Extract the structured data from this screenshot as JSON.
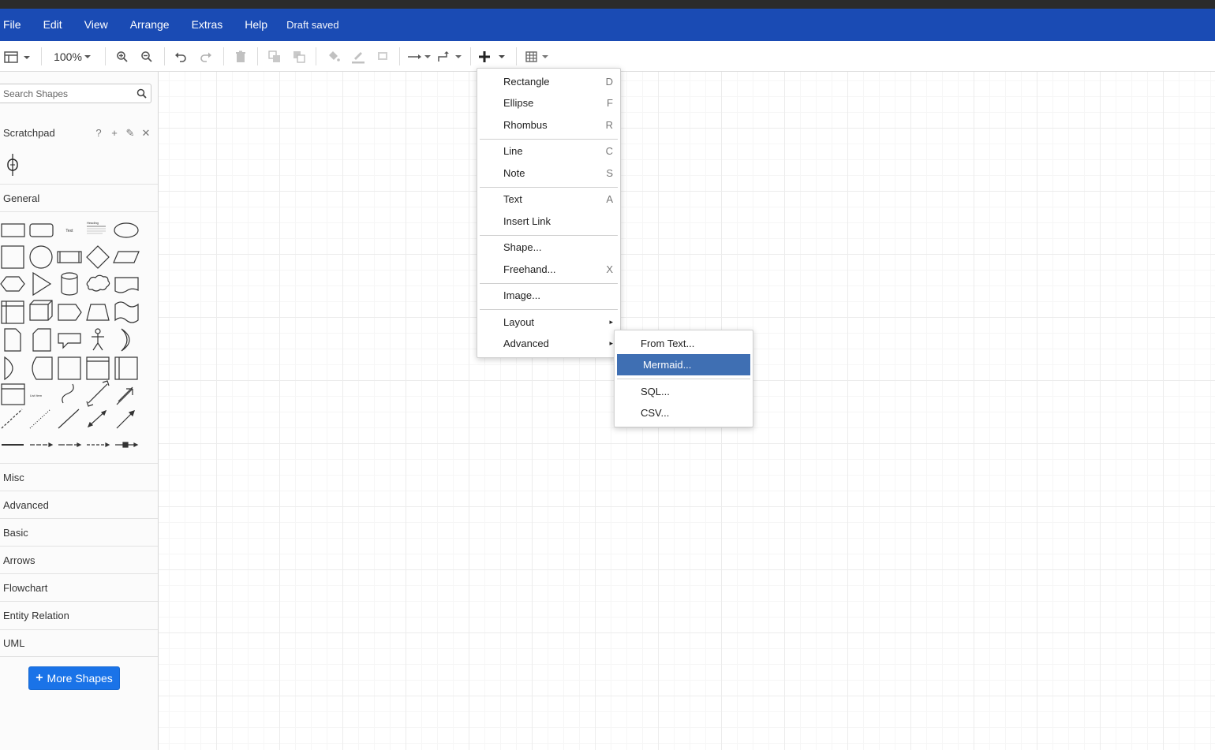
{
  "menubar": {
    "items": [
      "File",
      "Edit",
      "View",
      "Arrange",
      "Extras",
      "Help"
    ],
    "status": "Draft saved"
  },
  "toolbar": {
    "zoom": "100%",
    "icons": [
      "panel-layout-icon",
      "zoom-in-icon",
      "zoom-out-icon",
      "undo-icon",
      "redo-icon",
      "delete-icon",
      "to-front-icon",
      "to-back-icon",
      "fill-color-icon",
      "line-color-icon",
      "shadow-icon",
      "connection-icon",
      "waypoints-icon",
      "insert-plus-icon",
      "table-icon"
    ]
  },
  "sidebar": {
    "search_placeholder": "Search Shapes",
    "scratchpad": {
      "label": "Scratchpad",
      "icons": [
        "?",
        "+",
        "✎",
        "✕"
      ]
    },
    "general": "General",
    "shape_text": "Text",
    "shape_heading": "Heading",
    "shape_list_item": "List Item",
    "sections": [
      "Misc",
      "Advanced",
      "Basic",
      "Arrows",
      "Flowchart",
      "Entity Relation",
      "UML"
    ],
    "more_shapes": "More Shapes"
  },
  "insert_menu": {
    "items": [
      {
        "label": "Rectangle",
        "shortcut": "D"
      },
      {
        "label": "Ellipse",
        "shortcut": "F"
      },
      {
        "label": "Rhombus",
        "shortcut": "R"
      },
      {
        "label": "Line",
        "shortcut": "C"
      },
      {
        "label": "Note",
        "shortcut": "S"
      },
      {
        "label": "Text",
        "shortcut": "A"
      },
      {
        "label": "Insert Link",
        "shortcut": ""
      },
      {
        "label": "Shape...",
        "shortcut": ""
      },
      {
        "label": "Freehand...",
        "shortcut": "X"
      },
      {
        "label": "Image...",
        "shortcut": ""
      },
      {
        "label": "Layout",
        "shortcut": "▸"
      },
      {
        "label": "Advanced",
        "shortcut": "▸"
      }
    ]
  },
  "advanced_submenu": {
    "items": [
      "From Text...",
      "Mermaid...",
      "SQL...",
      "CSV..."
    ],
    "highlighted": "Mermaid..."
  },
  "colors": {
    "menubar": "#1a4bb4",
    "highlight": "#3f6fb3",
    "more_button": "#1a73e8"
  }
}
